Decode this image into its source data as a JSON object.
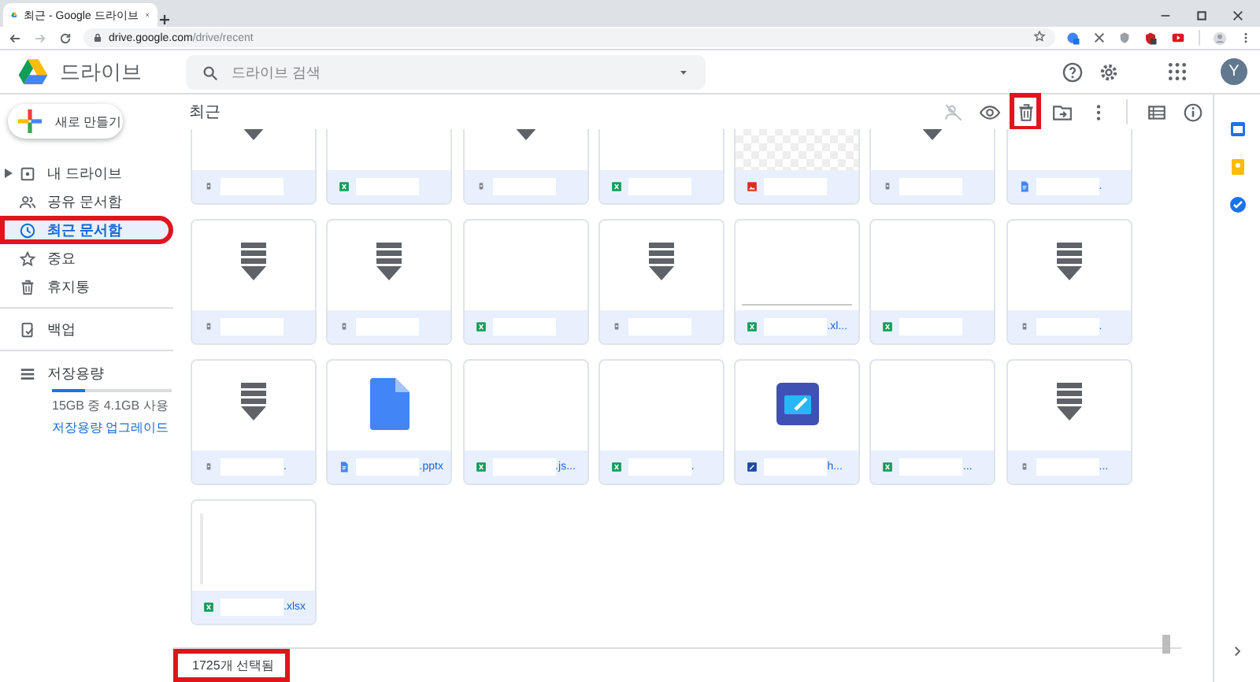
{
  "browser": {
    "tab_title": "최근 - Google 드라이브",
    "url_host": "drive.google.com",
    "url_path": "/drive/recent"
  },
  "app": {
    "name": "드라이브",
    "search_placeholder": "드라이브 검색",
    "avatar": "Y"
  },
  "sidebar": {
    "new_button": "새로 만들기",
    "items": [
      {
        "kind": "drive",
        "label": "내 드라이브",
        "expandable": true,
        "selected": false,
        "highlighted": false
      },
      {
        "kind": "shared",
        "label": "공유 문서함",
        "expandable": false,
        "selected": false,
        "highlighted": false
      },
      {
        "kind": "recent",
        "label": "최근 문서함",
        "expandable": false,
        "selected": true,
        "highlighted": true
      },
      {
        "kind": "starred",
        "label": "중요",
        "expandable": false,
        "selected": false,
        "highlighted": false
      },
      {
        "kind": "trash",
        "label": "휴지통",
        "expandable": false,
        "selected": false,
        "highlighted": false
      }
    ],
    "backup": "백업",
    "storage": {
      "label": "저장용량",
      "level": 0.27,
      "usage": "15GB 중 4.1GB 사용",
      "upgrade": "저장용량 업그레이드"
    }
  },
  "toolbar": {
    "title": "최근",
    "actions": [
      {
        "kind": "unshare",
        "highlighted": false
      },
      {
        "kind": "preview",
        "highlighted": false
      },
      {
        "kind": "trash",
        "highlighted": true
      },
      {
        "kind": "move",
        "highlighted": false
      },
      {
        "kind": "more",
        "highlighted": false
      },
      {
        "kind": "list-view",
        "highlighted": false
      },
      {
        "kind": "info",
        "highlighted": false
      }
    ]
  },
  "files": [
    {
      "thumbnail": {
        "kind": "download"
      },
      "icon": {
        "kind": "archive"
      }
    },
    {
      "thumbnail": {
        "kind": "blank"
      },
      "icon": {
        "kind": "sheet"
      }
    },
    {
      "thumbnail": {
        "kind": "download"
      },
      "icon": {
        "kind": "archive"
      }
    },
    {
      "thumbnail": {
        "kind": "blank"
      },
      "icon": {
        "kind": "sheet"
      }
    },
    {
      "thumbnail": {
        "kind": "checker"
      },
      "icon": {
        "kind": "image"
      }
    },
    {
      "thumbnail": {
        "kind": "download"
      },
      "icon": {
        "kind": "archive"
      }
    },
    {
      "thumbnail": {
        "kind": "blank"
      },
      "icon": {
        "kind": "doc"
      },
      "name": "."
    },
    {
      "thumbnail": {
        "kind": "download"
      },
      "icon": {
        "kind": "archive"
      }
    },
    {
      "thumbnail": {
        "kind": "download"
      },
      "icon": {
        "kind": "archive"
      }
    },
    {
      "thumbnail": {
        "kind": "blank"
      },
      "icon": {
        "kind": "sheet"
      }
    },
    {
      "thumbnail": {
        "kind": "download"
      },
      "icon": {
        "kind": "archive"
      }
    },
    {
      "thumbnail": {
        "kind": "line"
      },
      "icon": {
        "kind": "sheet"
      },
      "name": ".xl..."
    },
    {
      "thumbnail": {
        "kind": "blank"
      },
      "icon": {
        "kind": "sheet"
      }
    },
    {
      "thumbnail": {
        "kind": "download"
      },
      "icon": {
        "kind": "archive"
      },
      "name": "."
    },
    {
      "thumbnail": {
        "kind": "download"
      },
      "icon": {
        "kind": "archive"
      },
      "name": "."
    },
    {
      "thumbnail": {
        "kind": "doc"
      },
      "icon": {
        "kind": "doc"
      },
      "name": ".pptx"
    },
    {
      "thumbnail": {
        "kind": "blank"
      },
      "icon": {
        "kind": "sheet"
      },
      "name": ".js..."
    },
    {
      "thumbnail": {
        "kind": "blank"
      },
      "icon": {
        "kind": "sheet"
      },
      "name": "."
    },
    {
      "thumbnail": {
        "kind": "app"
      },
      "icon": {
        "kind": "app"
      },
      "name": "h..."
    },
    {
      "thumbnail": {
        "kind": "blank"
      },
      "icon": {
        "kind": "sheet"
      },
      "name": "..."
    },
    {
      "thumbnail": {
        "kind": "download"
      },
      "icon": {
        "kind": "archive"
      },
      "name": "..."
    },
    {
      "thumbnail": {
        "kind": "edge"
      },
      "icon": {
        "kind": "sheet"
      },
      "name": ".xlsx"
    }
  ],
  "status": {
    "text": "1725개 선택됨",
    "highlighted": true
  }
}
